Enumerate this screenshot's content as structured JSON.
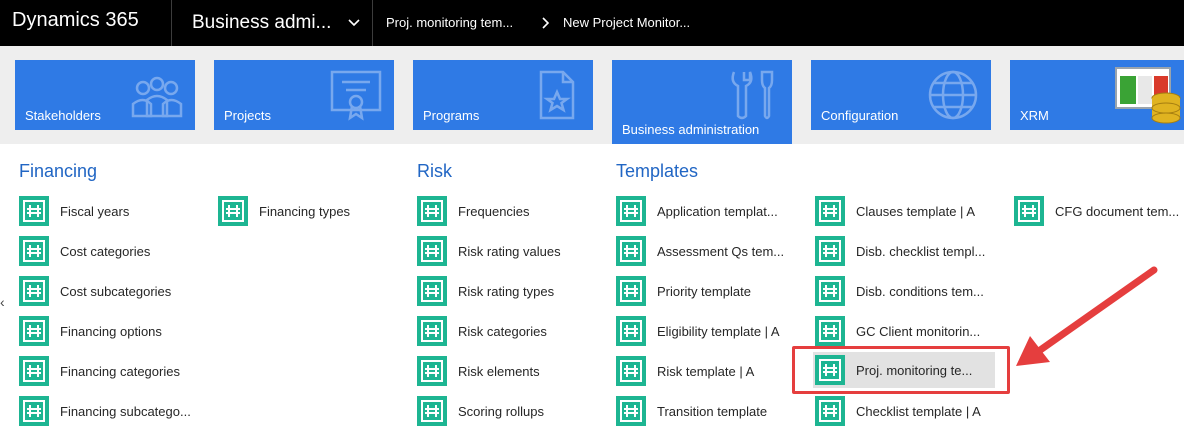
{
  "topbar": {
    "brand": "Dynamics 365",
    "area": "Business admi...",
    "breadcrumb_parent": "Proj. monitoring tem...",
    "breadcrumb_current": "New Project Monitor..."
  },
  "tiles": [
    {
      "label": "Stakeholders",
      "icon": "people-icon"
    },
    {
      "label": "Projects",
      "icon": "certificate-icon"
    },
    {
      "label": "Programs",
      "icon": "document-star-icon"
    },
    {
      "label": "Business administration",
      "icon": "tools-icon",
      "active": true
    },
    {
      "label": "Configuration",
      "icon": "globe-icon"
    },
    {
      "label": "XRM",
      "icon": "database-app-icon"
    }
  ],
  "groups": {
    "financing": {
      "title": "Financing",
      "items": [
        "Fiscal years",
        "Cost categories",
        "Cost subcategories",
        "Financing options",
        "Financing categories",
        "Financing subcatego...",
        "Financing types"
      ]
    },
    "risk": {
      "title": "Risk",
      "items": [
        "Frequencies",
        "Risk rating values",
        "Risk rating types",
        "Risk categories",
        "Risk elements",
        "Scoring rollups"
      ]
    },
    "templates": {
      "title": "Templates",
      "items": [
        "Application templat...",
        "Assessment Qs tem...",
        "Priority template",
        "Eligibility template | A",
        "Risk template | A",
        "Transition template",
        "Clauses template | A",
        "Disb. checklist templ...",
        "Disb. conditions tem...",
        "GC Client monitorin...",
        "Proj. monitoring te...",
        "Checklist template | A",
        "CFG document tem..."
      ]
    }
  },
  "colors": {
    "tile_blue": "#2f7ae5",
    "group_title": "#2166c4",
    "item_icon": "#1db592",
    "annotation_red": "#e53e3e"
  }
}
